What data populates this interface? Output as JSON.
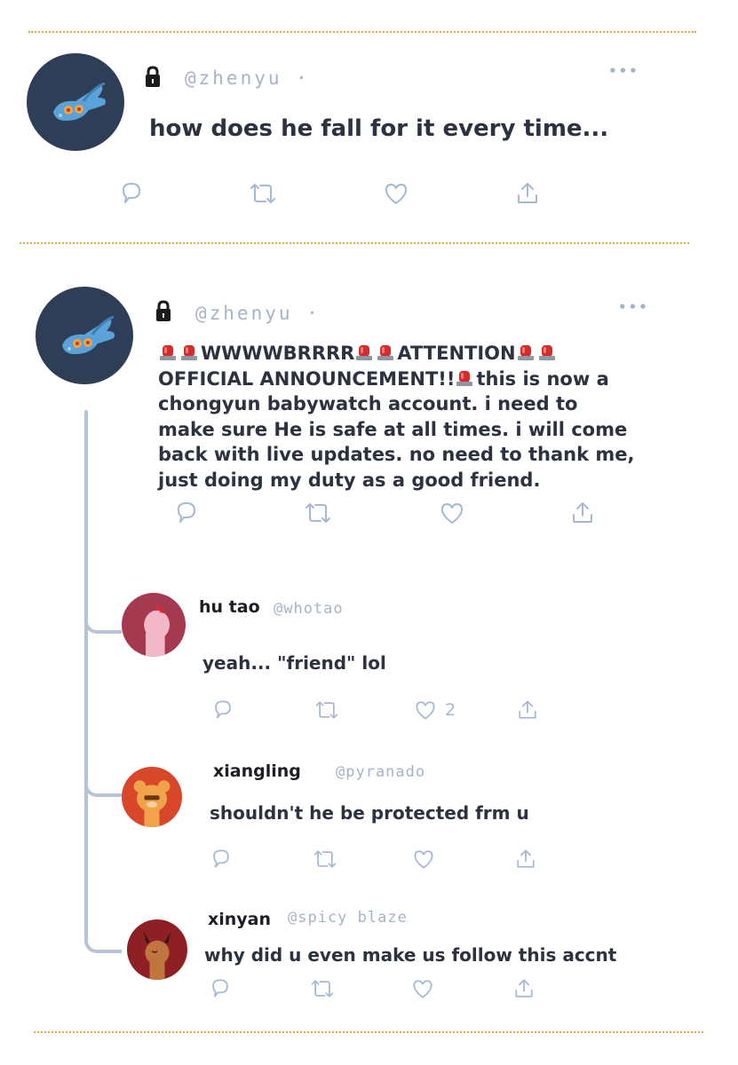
{
  "post1": {
    "handle": "@zhenyu ·",
    "text": "how does he fall for it every time...",
    "more": "•••"
  },
  "post2": {
    "handle": "@zhenyu ·",
    "more": "•••",
    "line1": "WWWWBRRRR",
    "line1b": "ATTENTION",
    "line2": "OFFICIAL ANNOUNCEMENT!!",
    "line2b": "this is now a",
    "line3": "chongyun babywatch account. i need to",
    "line4": "make sure He is safe at all times. i will come",
    "line5": "back with live updates. no need to thank me,",
    "line6": "just doing my duty as a good friend."
  },
  "replies": [
    {
      "name": "hu tao",
      "handle": "@whotao",
      "text": "yeah... \"friend\" lol",
      "likes": "2"
    },
    {
      "name": "xiangling",
      "handle": "@pyranado",
      "text": "shouldn't he be protected frm u"
    },
    {
      "name": "xinyan",
      "handle": "@spicy blaze",
      "text": "why did u even make us follow this accnt"
    }
  ],
  "icons": {
    "reply": "speech-bubble-icon",
    "retweet": "retweet-icon",
    "like": "heart-icon",
    "share": "share-icon",
    "lock": "lock-icon",
    "siren": "police-light-emoji"
  },
  "colors": {
    "divider": "#e8a64d",
    "icon": "#a6b8d2",
    "avatar_bg": "#2f3e57",
    "thread": "#b8c4d6"
  }
}
